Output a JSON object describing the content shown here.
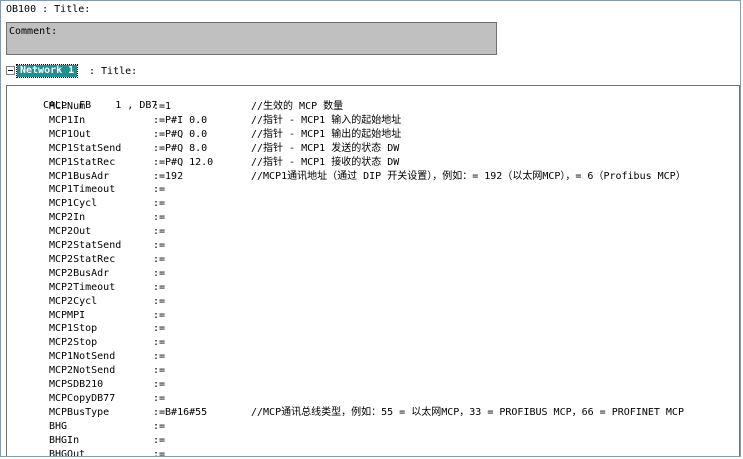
{
  "block_title": "OB100 : Title:",
  "comment_label": "Comment:",
  "network": {
    "label": "Network 1",
    "title": ": Title:"
  },
  "call_line": "CALL  FB    1 , DB7",
  "params": [
    {
      "name": "MCPNum",
      "assign": ":=1",
      "comment": "//生效的 MCP 数量"
    },
    {
      "name": "MCP1In",
      "assign": ":=P#I 0.0",
      "comment": "//指针 - MCP1 输入的起始地址"
    },
    {
      "name": "MCP1Out",
      "assign": ":=P#Q 0.0",
      "comment": "//指针 - MCP1 输出的起始地址"
    },
    {
      "name": "MCP1StatSend",
      "assign": ":=P#Q 8.0",
      "comment": "//指针 - MCP1 发送的状态 DW"
    },
    {
      "name": "MCP1StatRec",
      "assign": ":=P#Q 12.0",
      "comment": "//指针 - MCP1 接收的状态 DW"
    },
    {
      "name": "MCP1BusAdr",
      "assign": ":=192",
      "comment": "//MCP1通讯地址（通过 DIP 开关设置），例如：= 192（以太网MCP），= 6（Profibus MCP）"
    },
    {
      "name": "MCP1Timeout",
      "assign": ":=",
      "comment": ""
    },
    {
      "name": "MCP1Cycl",
      "assign": ":=",
      "comment": ""
    },
    {
      "name": "MCP2In",
      "assign": ":=",
      "comment": ""
    },
    {
      "name": "MCP2Out",
      "assign": ":=",
      "comment": ""
    },
    {
      "name": "MCP2StatSend",
      "assign": ":=",
      "comment": ""
    },
    {
      "name": "MCP2StatRec",
      "assign": ":=",
      "comment": ""
    },
    {
      "name": "MCP2BusAdr",
      "assign": ":=",
      "comment": ""
    },
    {
      "name": "MCP2Timeout",
      "assign": ":=",
      "comment": ""
    },
    {
      "name": "MCP2Cycl",
      "assign": ":=",
      "comment": ""
    },
    {
      "name": "MCPMPI",
      "assign": ":=",
      "comment": ""
    },
    {
      "name": "MCP1Stop",
      "assign": ":=",
      "comment": ""
    },
    {
      "name": "MCP2Stop",
      "assign": ":=",
      "comment": ""
    },
    {
      "name": "MCP1NotSend",
      "assign": ":=",
      "comment": ""
    },
    {
      "name": "MCP2NotSend",
      "assign": ":=",
      "comment": ""
    },
    {
      "name": "MCPSDB210",
      "assign": ":=",
      "comment": ""
    },
    {
      "name": "MCPCopyDB77",
      "assign": ":=",
      "comment": ""
    },
    {
      "name": "MCPBusType",
      "assign": ":=B#16#55",
      "comment": "//MCP通讯总线类型，例如：55 = 以太网MCP，33 = PROFIBUS MCP，66 = PROFINET MCP"
    },
    {
      "name": "BHG",
      "assign": ":=",
      "comment": ""
    },
    {
      "name": "BHGIn",
      "assign": ":=",
      "comment": ""
    },
    {
      "name": "BHGOut",
      "assign": ":=",
      "comment": ""
    }
  ]
}
